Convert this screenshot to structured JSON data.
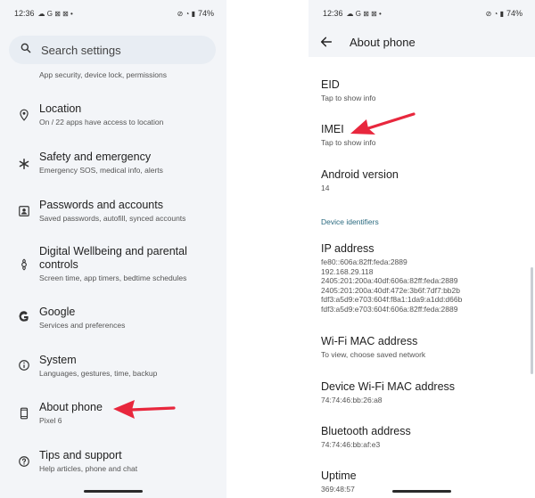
{
  "left": {
    "status": {
      "time": "12:36",
      "battery": "74%"
    },
    "search": {
      "placeholder": "Search settings"
    },
    "previous_subtitle": "App security, device lock, permissions",
    "items": [
      {
        "title": "Location",
        "subtitle": "On / 22 apps have access to location",
        "icon": "location-pin-icon"
      },
      {
        "title": "Safety and emergency",
        "subtitle": "Emergency SOS, medical info, alerts",
        "icon": "asterisk-icon"
      },
      {
        "title": "Passwords and accounts",
        "subtitle": "Saved passwords, autofill, synced accounts",
        "icon": "account-box-icon"
      },
      {
        "title": "Digital Wellbeing and parental controls",
        "subtitle": "Screen time, app timers, bedtime schedules",
        "icon": "wellbeing-icon"
      },
      {
        "title": "Google",
        "subtitle": "Services and preferences",
        "icon": "google-g-icon"
      },
      {
        "title": "System",
        "subtitle": "Languages, gestures, time, backup",
        "icon": "info-icon"
      },
      {
        "title": "About phone",
        "subtitle": "Pixel 6",
        "icon": "phone-icon"
      },
      {
        "title": "Tips and support",
        "subtitle": "Help articles, phone and chat",
        "icon": "help-icon"
      }
    ]
  },
  "right": {
    "status": {
      "time": "12:36",
      "battery": "74%"
    },
    "header": {
      "title": "About phone"
    },
    "rows": {
      "eid": {
        "title": "EID",
        "value": "Tap to show info"
      },
      "imei": {
        "title": "IMEI",
        "value": "Tap to show info"
      },
      "android_version": {
        "title": "Android version",
        "value": "14"
      }
    },
    "section_device_identifiers": "Device identifiers",
    "identifiers": {
      "ip": {
        "title": "IP address",
        "value": "fe80::606a:82ff:feda:2889\n192.168.29.118\n2405:201:200a:40df:606a:82ff:feda:2889\n2405:201:200a:40df:472e:3b6f:7df7:bb2b\nfdf3:a5d9:e703:604f:f8a1:1da9:a1dd:d66b\nfdf3:a5d9:e703:604f:606a:82ff:feda:2889"
      },
      "wifi_mac": {
        "title": "Wi-Fi MAC address",
        "value": "To view, choose saved network"
      },
      "device_wifi_mac": {
        "title": "Device Wi-Fi MAC address",
        "value": "74:74:46:bb:26:a8"
      },
      "bluetooth": {
        "title": "Bluetooth address",
        "value": "74:74:46:bb:af:e3"
      },
      "uptime": {
        "title": "Uptime",
        "value": "369:48:57"
      }
    }
  },
  "colors": {
    "annotation_arrow": "#e8273d",
    "section_header": "#2c6b80",
    "background": "#f3f5f8"
  }
}
